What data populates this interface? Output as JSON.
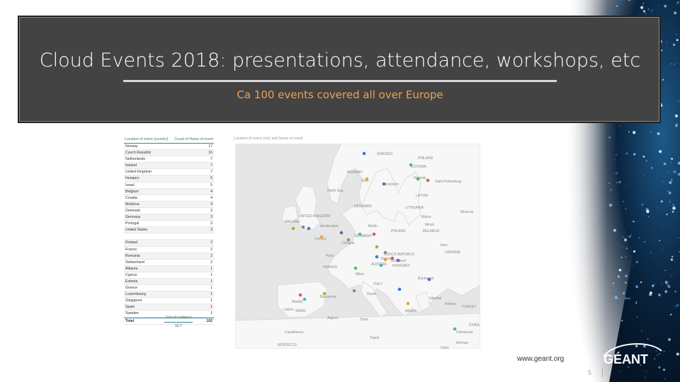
{
  "slide": {
    "title": "Cloud Events 2018: presentations, attendance, workshops, etc",
    "subtitle": "Ca 100 events covered all over Europe",
    "footer_url": "www.geant.org",
    "page_number": "5",
    "logo_text": "GÉANT"
  },
  "table": {
    "headers": [
      "Location of event (country)",
      "Count of Name of event"
    ],
    "rows": [
      {
        "country": "Norway",
        "count": "17"
      },
      {
        "country": "Czech Republic",
        "count": "16"
      },
      {
        "country": "Netherlands",
        "count": "7"
      },
      {
        "country": "Ireland",
        "count": "7"
      },
      {
        "country": "United Kingdom",
        "count": "7"
      },
      {
        "country": "Hungary",
        "count": "5"
      },
      {
        "country": "Israel",
        "count": "5"
      },
      {
        "country": "Belgium",
        "count": "4"
      },
      {
        "country": "Croatia",
        "count": "4"
      },
      {
        "country": "Moldova",
        "count": "4"
      },
      {
        "country": "Denmark",
        "count": "3"
      },
      {
        "country": "Germany",
        "count": "3"
      },
      {
        "country": "Portugal",
        "count": "3"
      },
      {
        "country": "United States",
        "count": "3"
      },
      {
        "country": "",
        "count": ""
      },
      {
        "country": "Finland",
        "count": "2"
      },
      {
        "country": "France",
        "count": "2"
      },
      {
        "country": "Romania",
        "count": "2"
      },
      {
        "country": "Switzerland",
        "count": "2"
      },
      {
        "country": "Albania",
        "count": "1"
      },
      {
        "country": "Cyprus",
        "count": "1"
      },
      {
        "country": "Estonia",
        "count": "1"
      },
      {
        "country": "Greece",
        "count": "1"
      },
      {
        "country": "Luxembourg",
        "count": "1"
      },
      {
        "country": "Singapore",
        "count": "1"
      },
      {
        "country": "Spain",
        "count": "1"
      },
      {
        "country": "Sweden",
        "count": "1"
      }
    ],
    "total_label": "Total",
    "total_value": "102"
  },
  "summary": {
    "label": "Size of audience",
    "value": "12.7"
  },
  "map": {
    "caption": "Location of event (city) and Name of event",
    "labels": [
      {
        "text": "SWEDEN"
      },
      {
        "text": "FINLAND"
      },
      {
        "text": "NORWAY"
      },
      {
        "text": "Oslo"
      },
      {
        "text": "Stockholm"
      },
      {
        "text": "Helsinki"
      },
      {
        "text": "Saint Petersburg"
      },
      {
        "text": "ESTONIA"
      },
      {
        "text": "LATVIA"
      },
      {
        "text": "North Sea"
      },
      {
        "text": "DENMARK"
      },
      {
        "text": "LITHUANIA"
      },
      {
        "text": "Moscow"
      },
      {
        "text": "Vilnius"
      },
      {
        "text": "Minsk"
      },
      {
        "text": "BELARUS"
      },
      {
        "text": "IRELAND"
      },
      {
        "text": "UNITED KINGDOM"
      },
      {
        "text": "Amsterdam"
      },
      {
        "text": "Berlin"
      },
      {
        "text": "POLAND"
      },
      {
        "text": "London"
      },
      {
        "text": "GERMANY"
      },
      {
        "text": "Cologne"
      },
      {
        "text": "Kiev"
      },
      {
        "text": "UKRAINE"
      },
      {
        "text": "Paris"
      },
      {
        "text": "CZECH REPUBLIC"
      },
      {
        "text": "Vienna"
      },
      {
        "text": "Budapest"
      },
      {
        "text": "AUSTRIA"
      },
      {
        "text": "HUNGARY"
      },
      {
        "text": "FRANCE"
      },
      {
        "text": "Milan"
      },
      {
        "text": "Bucharest"
      },
      {
        "text": "ITALY"
      },
      {
        "text": "Rome"
      },
      {
        "text": "Barcelona"
      },
      {
        "text": "Istanbul"
      },
      {
        "text": "Madrid"
      },
      {
        "text": "SPAIN"
      },
      {
        "text": "Lisbon"
      },
      {
        "text": "Ankara"
      },
      {
        "text": "TURKEY"
      },
      {
        "text": "Athens"
      },
      {
        "text": "Algiers"
      },
      {
        "text": "Tunis"
      },
      {
        "text": "SYRIA"
      },
      {
        "text": "Casablanca"
      },
      {
        "text": "Damascus"
      },
      {
        "text": "Amman"
      },
      {
        "text": "Tripoli"
      },
      {
        "text": "MOROCCO"
      },
      {
        "text": "Cairo"
      }
    ]
  }
}
